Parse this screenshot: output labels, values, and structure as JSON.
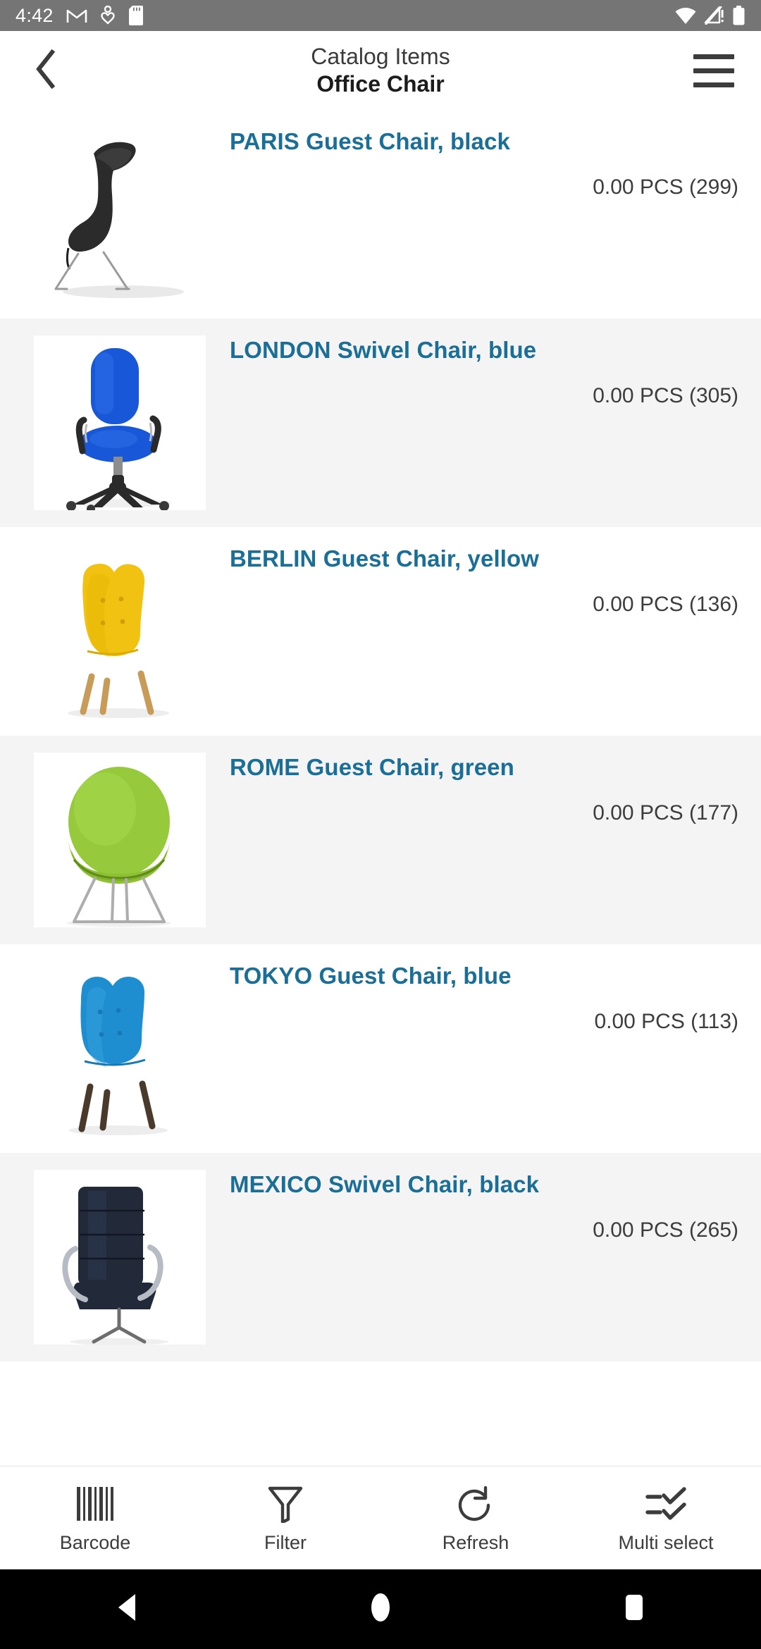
{
  "status_bar": {
    "time": "4:42",
    "left_icons": [
      "gmail-icon",
      "heart-person-icon",
      "sd-card-icon"
    ],
    "right_icons": [
      "wifi-icon",
      "no-sim-signal-icon",
      "battery-icon"
    ],
    "background_color": "#757575"
  },
  "header": {
    "back_label": "back-chevron",
    "title_line_1": "Catalog Items",
    "title_line_2": "Office Chair",
    "menu_label": "hamburger-menu"
  },
  "theme": {
    "link_color": "#1b6e96",
    "quantity_color": "#3d3d3d",
    "alt_row_color": "#f4f4f4"
  },
  "list": {
    "items": [
      {
        "name": "PARIS Guest Chair, black",
        "quantity": "0.00 PCS (299)",
        "thumb": "paris-black-chair"
      },
      {
        "name": "LONDON Swivel Chair, blue",
        "quantity": "0.00 PCS (305)",
        "thumb": "london-blue-chair"
      },
      {
        "name": "BERLIN Guest Chair, yellow",
        "quantity": "0.00 PCS (136)",
        "thumb": "berlin-yellow-chair"
      },
      {
        "name": "ROME Guest Chair, green",
        "quantity": "0.00 PCS (177)",
        "thumb": "rome-green-chair"
      },
      {
        "name": "TOKYO Guest Chair, blue",
        "quantity": "0.00 PCS (113)",
        "thumb": "tokyo-blue-chair"
      },
      {
        "name": "MEXICO Swivel Chair, black",
        "quantity": "0.00 PCS (265)",
        "thumb": "mexico-black-chair"
      }
    ]
  },
  "toolbar": {
    "items": [
      {
        "label": "Barcode",
        "icon": "barcode-icon"
      },
      {
        "label": "Filter",
        "icon": "funnel-icon"
      },
      {
        "label": "Refresh",
        "icon": "refresh-icon"
      },
      {
        "label": "Multi select",
        "icon": "checklist-icon"
      }
    ]
  },
  "navbar": {
    "back": "back-triangle-icon",
    "home": "home-circle-icon",
    "recents": "recents-square-icon"
  }
}
